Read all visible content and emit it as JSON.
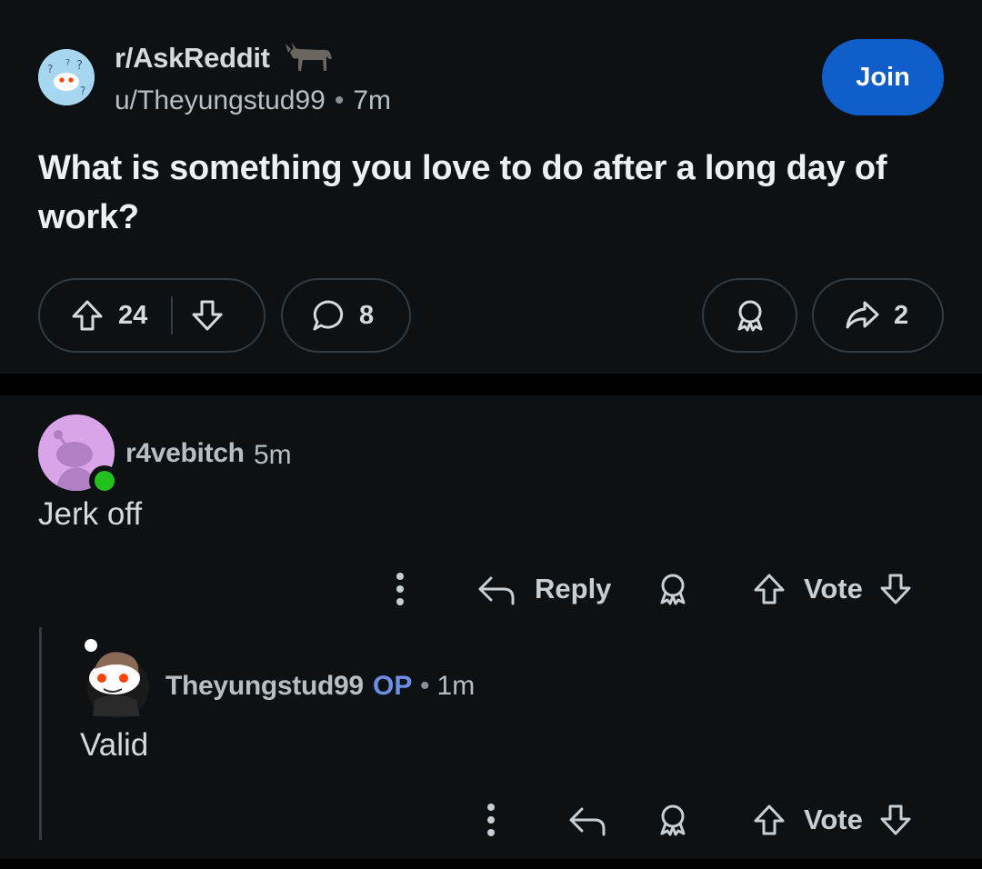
{
  "post": {
    "subreddit": "r/AskReddit",
    "author": "u/Theyungstud99",
    "separator": "•",
    "time": "7m",
    "join_label": "Join",
    "title": "What is something you love to do after a long day of work?",
    "votes": "24",
    "comments": "8",
    "shares": "2"
  },
  "comments": [
    {
      "author": "r4vebitch",
      "time": "5m",
      "body": "Jerk off",
      "reply_label": "Reply",
      "vote_label": "Vote"
    }
  ],
  "reply": {
    "author": "Theyungstud99",
    "op_badge": "OP",
    "separator": "•",
    "time": "1m",
    "body": "Valid",
    "vote_label": "Vote"
  },
  "colors": {
    "background": "#0e1113",
    "join": "#0f5ec9",
    "op": "#6e8fe8",
    "online": "#22c11e"
  }
}
